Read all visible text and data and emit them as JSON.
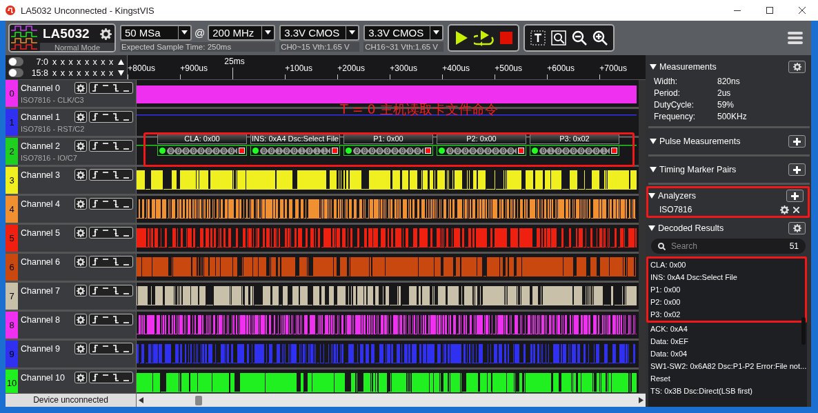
{
  "window": {
    "title": "LA5032 Unconnected - KingstVIS"
  },
  "toolbar": {
    "device": {
      "name": "LA5032",
      "mode": "Normal Mode"
    },
    "sample_depth": "50 MSa",
    "at": "@",
    "sample_rate": "200 MHz",
    "expected": "Expected Sample Time: 250ms",
    "thresholds": [
      {
        "value": "3.3V CMOS",
        "range": "CH0~15 Vth:1.65 V"
      },
      {
        "value": "3.3V CMOS",
        "range": "CH16~31 Vth:1.65 V"
      }
    ]
  },
  "bit_rows": [
    {
      "label": "7:0",
      "bits": "x x x x x x x x",
      "on": false
    },
    {
      "label": "15:8",
      "bits": "x x x x x x x x",
      "on": false
    }
  ],
  "ruler": [
    {
      "label": "+800us",
      "kind": "minor"
    },
    {
      "label": "+900us",
      "kind": "minor"
    },
    {
      "label": "25ms",
      "kind": "major"
    },
    {
      "label": "+100us",
      "kind": "minor"
    },
    {
      "label": "+200us",
      "kind": "minor"
    },
    {
      "label": "+300us",
      "kind": "minor"
    },
    {
      "label": "+400us",
      "kind": "minor"
    },
    {
      "label": "+500us",
      "kind": "minor"
    },
    {
      "label": "+600us",
      "kind": "minor"
    },
    {
      "label": "+700us",
      "kind": "minor"
    }
  ],
  "channels": [
    {
      "number": "0",
      "name": "Channel 0",
      "protocol": "ISO7816 - CLK/C3",
      "color": "#f030f0",
      "kind": "clock"
    },
    {
      "number": "1",
      "name": "Channel 1",
      "protocol": "ISO7816 - RST/C2",
      "color": "#3030f0",
      "kind": "line"
    },
    {
      "number": "2",
      "name": "Channel 2",
      "protocol": "ISO7816 - IO/C7",
      "color": "#20d020",
      "kind": "decoded",
      "highlighted": true,
      "frames": [
        {
          "label": "CLA: 0x00",
          "bits": "000000000"
        },
        {
          "label": "INS: 0xA4 Dsc:Select File",
          "bits": "001001011"
        },
        {
          "label": "P1: 0x00",
          "bits": "000000000"
        },
        {
          "label": "P2: 0x00",
          "bits": "000000000"
        },
        {
          "label": "P3: 0x02",
          "bits": "010000001"
        }
      ]
    },
    {
      "number": "3",
      "name": "Channel 3",
      "color": "#f0f020",
      "kind": "pulses"
    },
    {
      "number": "4",
      "name": "Channel 4",
      "color": "#f09030",
      "kind": "pulses"
    },
    {
      "number": "5",
      "name": "Channel 5",
      "color": "#f02010",
      "kind": "pulses"
    },
    {
      "number": "6",
      "name": "Channel 6",
      "color": "#c84810",
      "kind": "pulses"
    },
    {
      "number": "7",
      "name": "Channel 7",
      "color": "#c8c0a8",
      "kind": "pulses"
    },
    {
      "number": "8",
      "name": "Channel 8",
      "color": "#f030f0",
      "kind": "pulses"
    },
    {
      "number": "9",
      "name": "Channel 9",
      "color": "#3030f0",
      "kind": "pulses"
    },
    {
      "number": "10",
      "name": "Channel 10",
      "color": "#20f020",
      "kind": "pulses"
    }
  ],
  "annotation": "T = 0 主机读取卡文件命令",
  "status": "Device unconnected",
  "panel": {
    "measurements": {
      "title": "Measurements",
      "expanded": true,
      "rows": [
        {
          "label": "Width:",
          "value": "820ns"
        },
        {
          "label": "Period:",
          "value": "2us"
        },
        {
          "label": "DutyCycle:",
          "value": "59%"
        },
        {
          "label": "Frequency:",
          "value": "500KHz"
        }
      ]
    },
    "sections": [
      {
        "title": "Pulse Measurements",
        "expanded": true
      },
      {
        "title": "Timing Marker Pairs",
        "expanded": true
      }
    ],
    "analyzers": {
      "title": "Analyzers",
      "expanded": true,
      "highlighted": true,
      "items": [
        "ISO7816"
      ]
    },
    "decoded": {
      "title": "Decoded Results",
      "expanded": true,
      "placeholder": "Search",
      "count": "51",
      "results": [
        {
          "text": "CLA: 0x00",
          "highlighted": true
        },
        {
          "text": "INS: 0xA4 Dsc:Select File",
          "highlighted": true
        },
        {
          "text": "P1: 0x00",
          "highlighted": true
        },
        {
          "text": "P2: 0x00",
          "highlighted": true
        },
        {
          "text": "P3: 0x02",
          "highlighted": true
        },
        {
          "text": "ACK: 0xA4",
          "highlighted": false
        },
        {
          "text": "Data: 0xEF",
          "highlighted": false
        },
        {
          "text": "Data: 0x04",
          "highlighted": false
        },
        {
          "text": "SW1-SW2: 0x6A82 Dsc:P1-P2 Error:File not...",
          "highlighted": false
        },
        {
          "text": "Reset",
          "highlighted": false
        },
        {
          "text": "TS: 0x3B Dsc:Direct(LSB first)",
          "highlighted": false
        }
      ]
    }
  }
}
